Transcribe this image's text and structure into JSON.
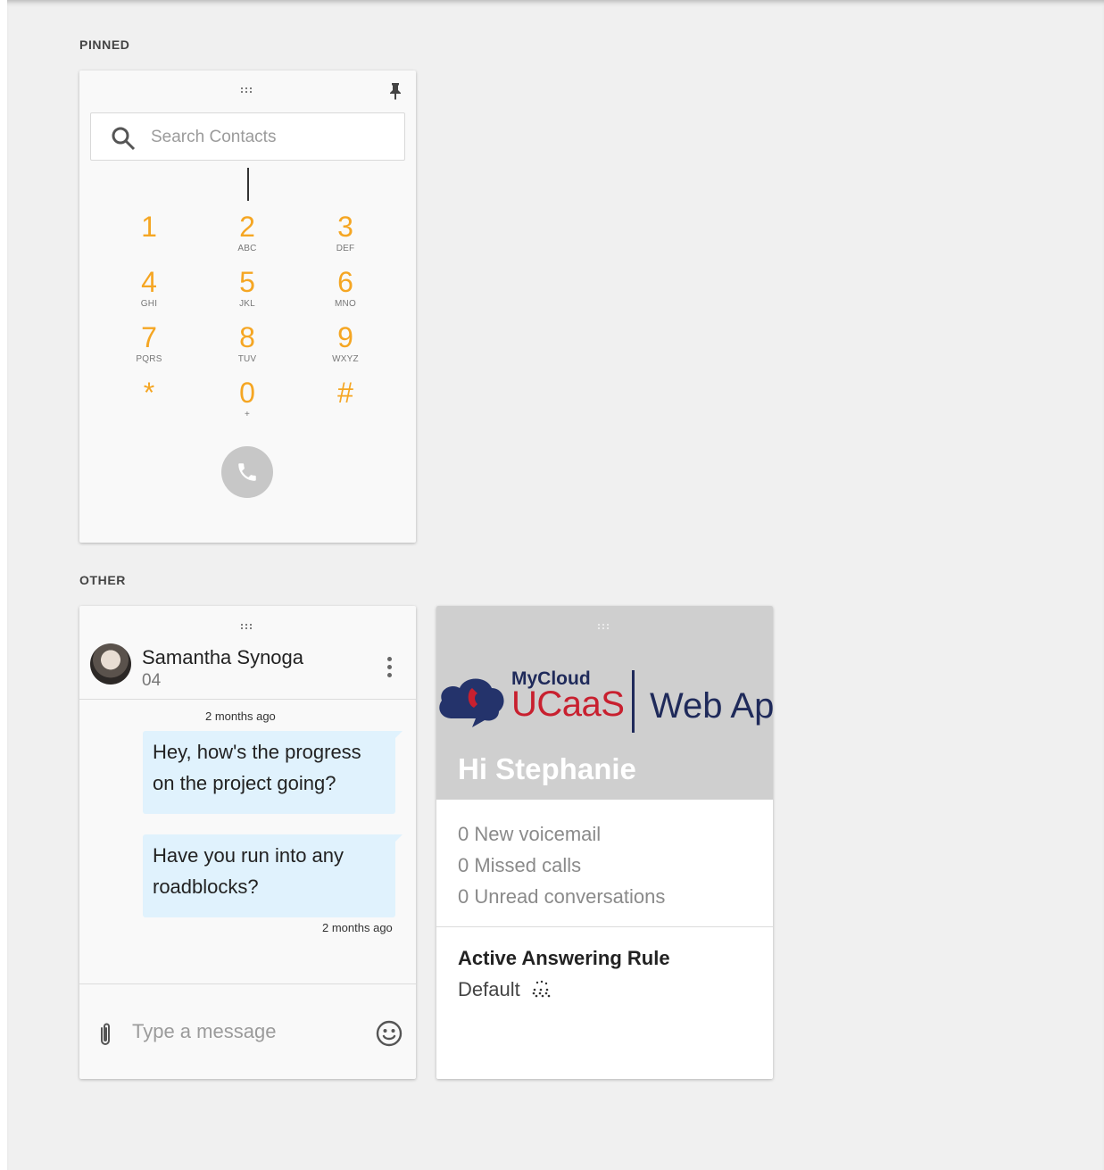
{
  "sections": {
    "pinned": "PINNED",
    "other": "OTHER"
  },
  "dialer": {
    "search_placeholder": "Search Contacts",
    "keys": [
      {
        "digit": "1",
        "letters": ""
      },
      {
        "digit": "2",
        "letters": "ABC"
      },
      {
        "digit": "3",
        "letters": "DEF"
      },
      {
        "digit": "4",
        "letters": "GHI"
      },
      {
        "digit": "5",
        "letters": "JKL"
      },
      {
        "digit": "6",
        "letters": "MNO"
      },
      {
        "digit": "7",
        "letters": "PQRS"
      },
      {
        "digit": "8",
        "letters": "TUV"
      },
      {
        "digit": "9",
        "letters": "WXYZ"
      },
      {
        "digit": "*",
        "letters": ""
      },
      {
        "digit": "0",
        "letters": "+"
      },
      {
        "digit": "#",
        "letters": ""
      }
    ],
    "accent_color": "#f5a623",
    "icons": [
      "drag-handle-icon",
      "pin-icon",
      "search-icon",
      "phone-icon"
    ]
  },
  "chat": {
    "contact_name": "Samantha Synoga",
    "contact_sub": "04",
    "timestamp_top": "2 months ago",
    "messages": [
      "Hey, how's the progress on the project going?",
      "Have you run into any roadblocks?"
    ],
    "timestamp_bottom": "2 months ago",
    "input_placeholder": "Type a message",
    "bubble_color": "#e0f2fd",
    "icons": [
      "drag-handle-icon",
      "more-vertical-icon",
      "paperclip-icon",
      "emoji-icon"
    ]
  },
  "home": {
    "logo_top": "MyCloud",
    "logo_main": "UCaaS",
    "logo_suffix": "Web Ap",
    "greeting": "Hi Stephanie",
    "stats": [
      "0 New voicemail",
      "0 Missed calls",
      "0 Unread conversations"
    ],
    "rule_heading": "Active Answering Rule",
    "rule_value": "Default",
    "brand_colors": {
      "navy": "#1f2a5a",
      "red": "#c8202f"
    },
    "icons": [
      "drag-handle-icon",
      "cloud-phone-logo-icon",
      "dots-pattern-icon"
    ]
  }
}
